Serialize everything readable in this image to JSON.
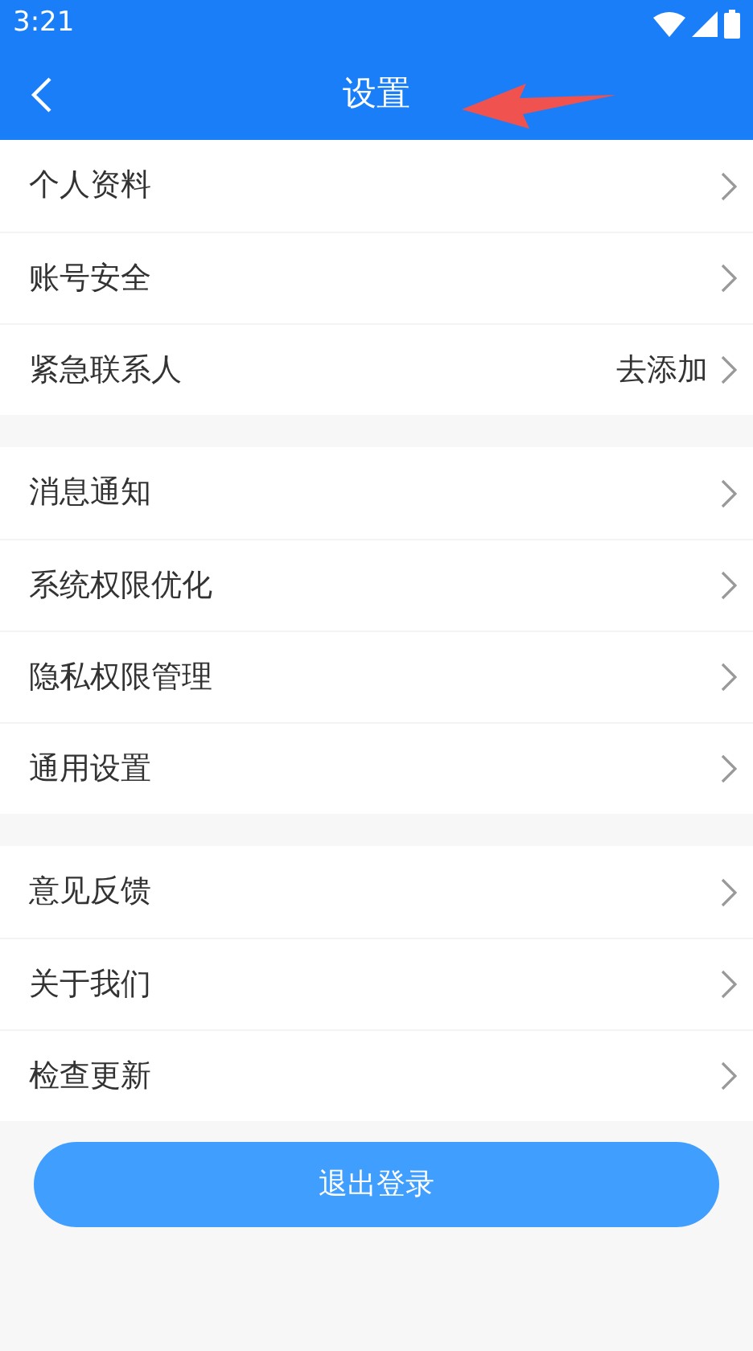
{
  "status_bar": {
    "time": "3:21"
  },
  "header": {
    "title": "设置"
  },
  "groups": [
    {
      "rows": [
        {
          "label": "个人资料"
        },
        {
          "label": "账号安全"
        },
        {
          "label": "紧急联系人",
          "value": "去添加"
        }
      ]
    },
    {
      "rows": [
        {
          "label": "消息通知"
        },
        {
          "label": "系统权限优化"
        },
        {
          "label": "隐私权限管理"
        },
        {
          "label": "通用设置"
        }
      ]
    },
    {
      "rows": [
        {
          "label": "意见反馈"
        },
        {
          "label": "关于我们"
        },
        {
          "label": "检查更新"
        }
      ]
    }
  ],
  "logout_button": {
    "label": "退出登录"
  }
}
